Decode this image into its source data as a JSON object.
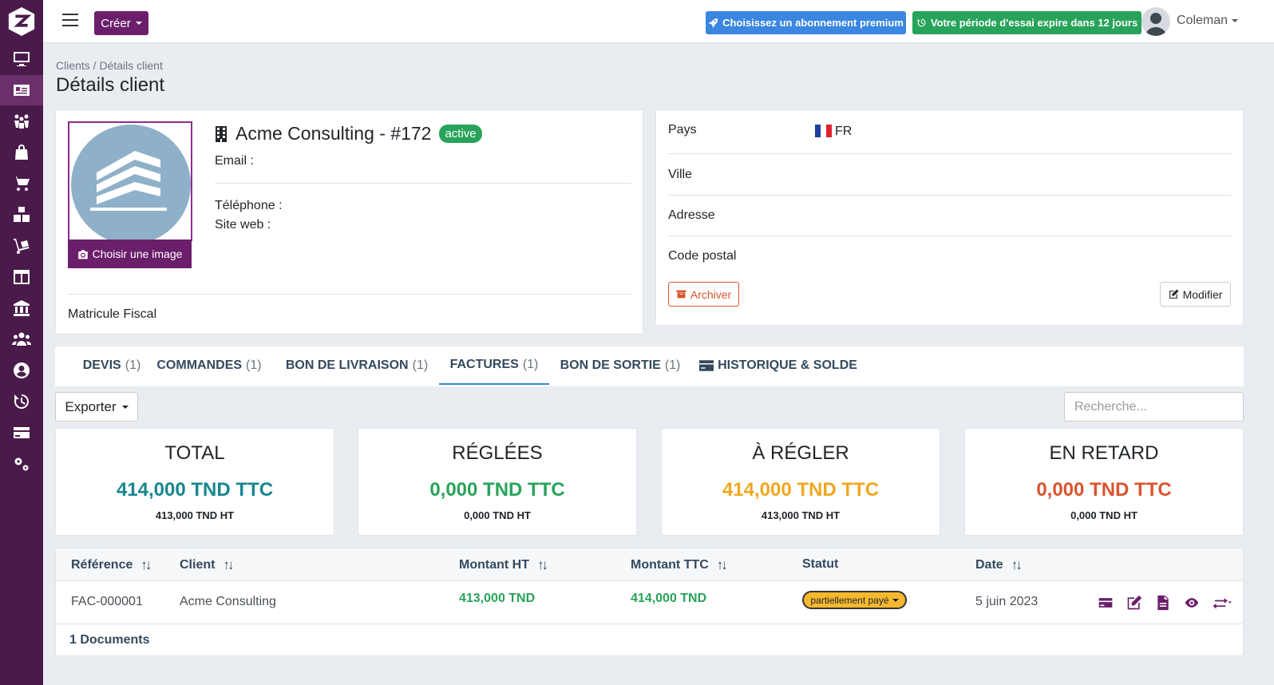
{
  "topbar": {
    "create_label": "Créer",
    "premium_label": "Choisissez un abonnement premium",
    "trial_label": "Votre période d'essai expire dans 12 jours",
    "user_name": "Coleman"
  },
  "sidebar": {
    "items": [
      "desktop-icon",
      "id-card-icon",
      "people-group-icon",
      "shopping-bag-icon",
      "cart-icon",
      "boxes-icon",
      "dolly-icon",
      "columns-icon",
      "bank-icon",
      "users-icon",
      "user-circle-icon",
      "history-icon",
      "credit-card-icon",
      "cogs-icon"
    ],
    "active_index": 1
  },
  "breadcrumb": "Clients / Détails client",
  "page_title": "Détails client",
  "client": {
    "name": "Acme Consulting - #172",
    "status": "active",
    "email_label": "Email :",
    "phone_label": "Téléphone :",
    "website_label": "Site web :",
    "choose_image_label": "Choisir une image",
    "tax_id_label": "Matricule Fiscal"
  },
  "address": {
    "country_label": "Pays",
    "country_code": "FR",
    "city_label": "Ville",
    "address_label": "Adresse",
    "postal_label": "Code postal",
    "archive_label": "Archiver",
    "edit_label": "Modifier"
  },
  "tabs": [
    {
      "label": "DEVIS",
      "count": "(1)"
    },
    {
      "label": "COMMANDES",
      "count": "(1)"
    },
    {
      "label": "BON DE LIVRAISON",
      "count": "(1)"
    },
    {
      "label": "FACTURES",
      "count": "(1)"
    },
    {
      "label": "BON DE SORTIE",
      "count": "(1)"
    },
    {
      "label": "HISTORIQUE & SOLDE",
      "count": ""
    }
  ],
  "active_tab": "FACTURES",
  "toolbar": {
    "export_label": "Exporter",
    "search_placeholder": "Recherche..."
  },
  "stats": [
    {
      "title": "TOTAL",
      "ttc": "414,000 TND TTC",
      "ht": "413,000 TND HT",
      "color": "#17868f"
    },
    {
      "title": "RÉGLÉES",
      "ttc": "0,000 TND TTC",
      "ht": "0,000 TND HT",
      "color": "#28a35a"
    },
    {
      "title": "À RÉGLER",
      "ttc": "414,000 TND TTC",
      "ht": "413,000 TND HT",
      "color": "#f0a71f"
    },
    {
      "title": "EN RETARD",
      "ttc": "0,000 TND TTC",
      "ht": "0,000 TND HT",
      "color": "#d9542f"
    }
  ],
  "table": {
    "headers": [
      "Référence",
      "Client",
      "Montant HT",
      "Montant TTC",
      "Statut",
      "Date"
    ],
    "rows": [
      {
        "reference": "FAC-000001",
        "client": "Acme Consulting",
        "montant_ht": "413,000 TND",
        "montant_ttc": "414,000 TND",
        "statut": "partiellement payé",
        "date": "5 juin 2023"
      }
    ],
    "footer": "1 Documents"
  },
  "colors": {
    "sidebar": "#4a1a4a",
    "brand": "#6b1f6b",
    "premium": "#3a86e0",
    "trial": "#28a35a"
  }
}
